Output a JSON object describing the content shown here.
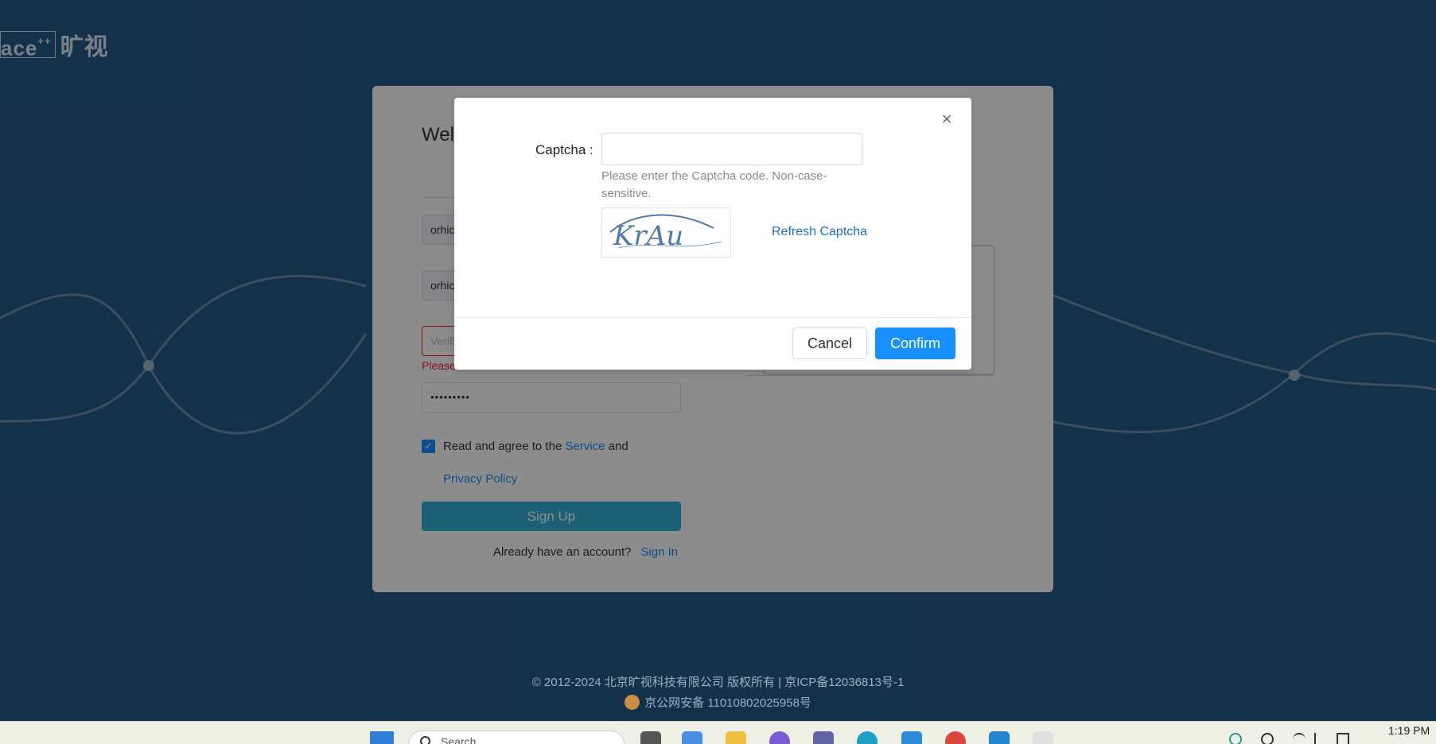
{
  "logo": {
    "text": "ace",
    "sup": "++",
    "cn": "旷视"
  },
  "signup": {
    "welcome": "Welc",
    "field1_value": "orhic",
    "field2_value": "orhic",
    "verification_placeholder": "Verifi",
    "error_text": "Please enter verification code.",
    "password_value": "•••••••••",
    "agree_text": "Read and agree to the",
    "service_link": "Service",
    "and_text": "and",
    "privacy_link": "Privacy Policy",
    "signup_button": "Sign Up",
    "already_text": "Already have an account?",
    "signin_link": "Sign In"
  },
  "modal": {
    "close_icon": "×",
    "captcha_label": "Captcha :",
    "captcha_value": "",
    "hint": "Please enter the Captcha code. Non-case-sensitive.",
    "captcha_image_text": "KrAu",
    "refresh_label": "Refresh Captcha",
    "cancel_label": "Cancel",
    "confirm_label": "Confirm"
  },
  "footer": {
    "line1": "© 2012-2024 北京旷视科技有限公司 版权所有 | 京ICP备12036813号-1",
    "line2": "京公网安备 11010802025958号"
  },
  "taskbar": {
    "search_placeholder": "Search",
    "clock": "1:19 PM"
  },
  "colors": {
    "background": "#26598a",
    "primary": "#1890ff",
    "error": "#f5222d",
    "link": "#1c6ec9"
  }
}
